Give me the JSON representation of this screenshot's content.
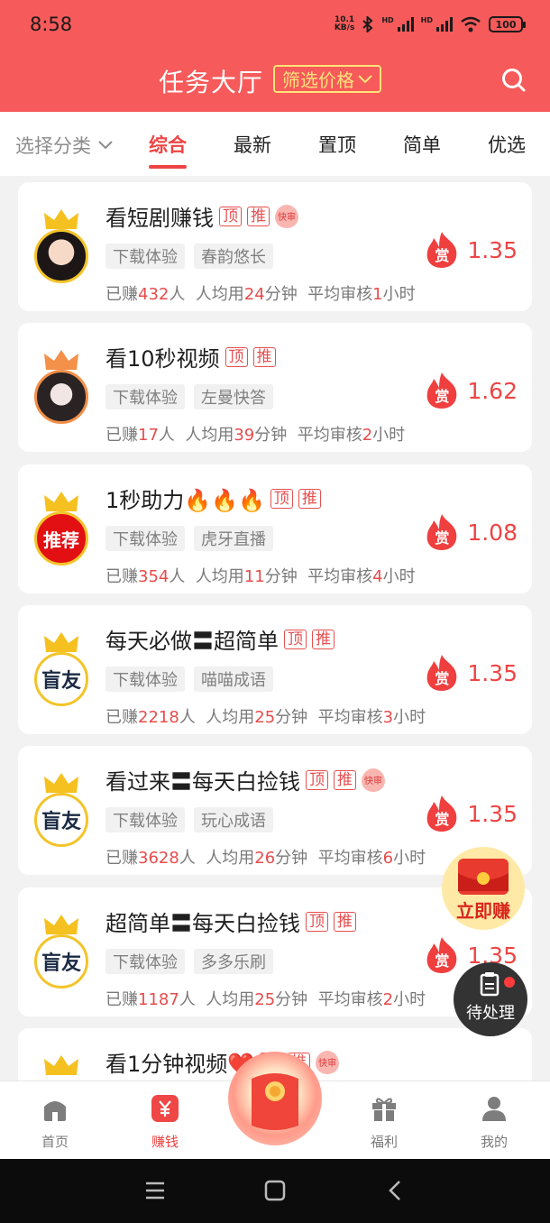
{
  "status_bar": {
    "time": "8:58",
    "net_speed_top": "10.1",
    "net_speed_unit": "KB/s",
    "battery": "100"
  },
  "header": {
    "title": "任务大厅",
    "filter_label": "筛选价格"
  },
  "tabs": {
    "category_select": "选择分类",
    "items": [
      "综合",
      "最新",
      "置顶",
      "简单",
      "优选"
    ],
    "active": "综合"
  },
  "tasks": [
    {
      "title": "看短剧赚钱",
      "badges": [
        "顶",
        "推"
      ],
      "quick_review": "快审",
      "tags": [
        "下载体验",
        "春韵悠长"
      ],
      "stats": {
        "earned_prefix": "已赚",
        "earned": "432",
        "earned_suffix": "人",
        "avg_prefix": "人均用",
        "avg": "24",
        "avg_suffix": "分钟",
        "review_prefix": "平均审核",
        "review": "1",
        "review_suffix": "小时"
      },
      "reward_icon": "赏",
      "price": "1.35"
    },
    {
      "title": "看10秒视频",
      "badges": [
        "顶",
        "推"
      ],
      "quick_review": "",
      "tags": [
        "下载体验",
        "左曼快答"
      ],
      "stats": {
        "earned_prefix": "已赚",
        "earned": "17",
        "earned_suffix": "人",
        "avg_prefix": "人均用",
        "avg": "39",
        "avg_suffix": "分钟",
        "review_prefix": "平均审核",
        "review": "2",
        "review_suffix": "小时"
      },
      "reward_icon": "赏",
      "price": "1.62"
    },
    {
      "title": "1秒助力🔥🔥🔥",
      "badges": [
        "顶",
        "推"
      ],
      "quick_review": "",
      "tags": [
        "下载体验",
        "虎牙直播"
      ],
      "avatar_text": "推荐",
      "stats": {
        "earned_prefix": "已赚",
        "earned": "354",
        "earned_suffix": "人",
        "avg_prefix": "人均用",
        "avg": "11",
        "avg_suffix": "分钟",
        "review_prefix": "平均审核",
        "review": "4",
        "review_suffix": "小时"
      },
      "reward_icon": "赏",
      "price": "1.08"
    },
    {
      "title": "每天必做〓超简单",
      "badges": [
        "顶",
        "推"
      ],
      "quick_review": "",
      "tags": [
        "下载体验",
        "喵喵成语"
      ],
      "avatar_text": "盲友",
      "stats": {
        "earned_prefix": "已赚",
        "earned": "2218",
        "earned_suffix": "人",
        "avg_prefix": "人均用",
        "avg": "25",
        "avg_suffix": "分钟",
        "review_prefix": "平均审核",
        "review": "3",
        "review_suffix": "小时"
      },
      "reward_icon": "赏",
      "price": "1.35"
    },
    {
      "title": "看过来〓每天白捡钱",
      "badges": [
        "顶",
        "推"
      ],
      "quick_review": "快审",
      "tags": [
        "下载体验",
        "玩心成语"
      ],
      "avatar_text": "盲友",
      "stats": {
        "earned_prefix": "已赚",
        "earned": "3628",
        "earned_suffix": "人",
        "avg_prefix": "人均用",
        "avg": "26",
        "avg_suffix": "分钟",
        "review_prefix": "平均审核",
        "review": "6",
        "review_suffix": "小时"
      },
      "reward_icon": "赏",
      "price": "1.35"
    },
    {
      "title": "超简单〓每天白捡钱",
      "badges": [
        "顶",
        "推"
      ],
      "quick_review": "",
      "tags": [
        "下载体验",
        "多多乐刷"
      ],
      "avatar_text": "盲友",
      "stats": {
        "earned_prefix": "已赚",
        "earned": "1187",
        "earned_suffix": "人",
        "avg_prefix": "人均用",
        "avg": "25",
        "avg_suffix": "分钟",
        "review_prefix": "平均审核",
        "review": "2",
        "review_suffix": "小时"
      },
      "reward_icon": "赏",
      "price": "1.35"
    },
    {
      "title": "看1分钟视频❤️",
      "badges": [
        "顶",
        "推"
      ],
      "quick_review": "快审"
    }
  ],
  "floating": {
    "earn_now": "立即赚",
    "pending": "待处理"
  },
  "bottom_nav": [
    {
      "label": "首页",
      "icon": "home-icon"
    },
    {
      "label": "赚钱",
      "icon": "yuan-icon"
    },
    {
      "label": "",
      "icon": "red-envelope-icon"
    },
    {
      "label": "福利",
      "icon": "gift-icon"
    },
    {
      "label": "我的",
      "icon": "user-icon"
    }
  ],
  "colors": {
    "brand": "#f65a5a",
    "accent": "#ee4444",
    "filter": "#ffe37a"
  }
}
